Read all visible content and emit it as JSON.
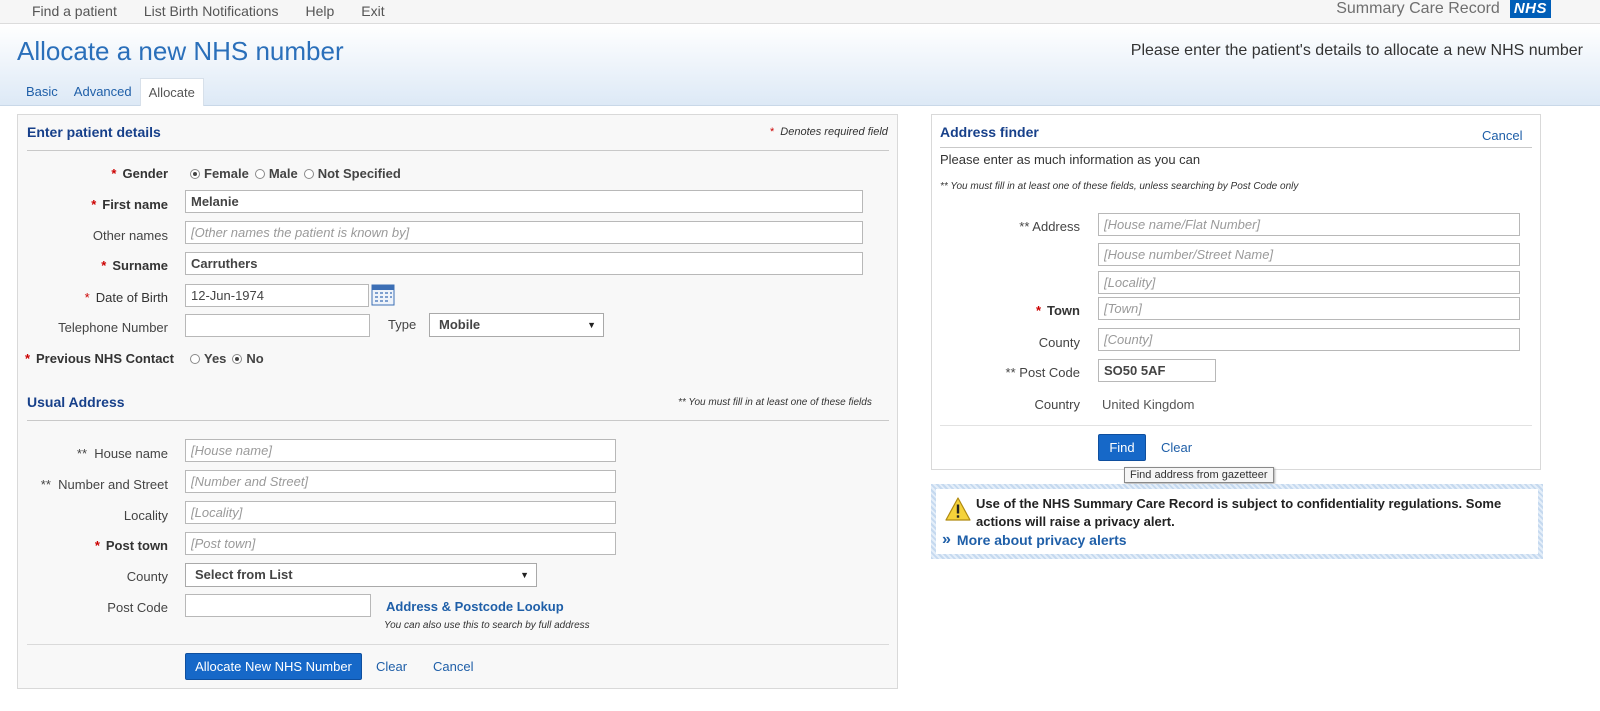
{
  "topnav": {
    "items": [
      "Find a patient",
      "List Birth Notifications",
      "Help",
      "Exit"
    ],
    "brand_title": "Summary Care Record",
    "brand_logo": "NHS"
  },
  "header": {
    "title": "Allocate a new NHS number",
    "subtitle": "Please enter the patient's details to allocate a new NHS number",
    "tabs": [
      {
        "label": "Basic",
        "active": false
      },
      {
        "label": "Advanced",
        "active": false
      },
      {
        "label": "Allocate",
        "active": true
      }
    ]
  },
  "patient": {
    "title": "Enter patient details",
    "required_star": "*",
    "required_note": "Denotes required field",
    "gender": {
      "label": "Gender",
      "options": [
        "Female",
        "Male",
        "Not Specified"
      ],
      "selected": "Female"
    },
    "first_name": {
      "label": "First name",
      "value": "Melanie"
    },
    "other_names": {
      "label": "Other names",
      "placeholder": "[Other names the patient is known by]"
    },
    "surname": {
      "label": "Surname",
      "value": "Carruthers"
    },
    "dob": {
      "label": "Date of Birth",
      "value": "12-Jun-1974"
    },
    "telephone": {
      "label": "Telephone Number",
      "value": ""
    },
    "type": {
      "label": "Type",
      "value": "Mobile"
    },
    "previous_contact": {
      "label": "Previous NHS Contact",
      "options": [
        "Yes",
        "No"
      ],
      "selected": "No"
    }
  },
  "usual_address": {
    "title": "Usual Address",
    "note": "** You must fill in at least one of these fields",
    "house_name": {
      "marker": "**",
      "label": "House name",
      "placeholder": "[House name]"
    },
    "number_street": {
      "marker": "**",
      "label": "Number and Street",
      "placeholder": "[Number and Street]"
    },
    "locality": {
      "label": "Locality",
      "placeholder": "[Locality]"
    },
    "post_town": {
      "label": "Post town",
      "placeholder": "[Post town]"
    },
    "county": {
      "label": "County",
      "value": "Select from List"
    },
    "post_code": {
      "label": "Post Code",
      "value": ""
    },
    "lookup_link": "Address & Postcode Lookup",
    "lookup_note": "You can also use this to search by full address"
  },
  "actions": {
    "allocate": "Allocate New NHS Number",
    "clear": "Clear",
    "cancel": "Cancel"
  },
  "finder": {
    "title": "Address finder",
    "cancel": "Cancel",
    "intro": "Please enter as much information as you can",
    "note": "** You must fill in at least one of these fields, unless searching by Post Code only",
    "address": {
      "marker": "**",
      "label": "Address",
      "placeholders": [
        "[House name/Flat Number]",
        "[House number/Street Name]",
        "[Locality]"
      ]
    },
    "town": {
      "label": "Town",
      "placeholder": "[Town]"
    },
    "county": {
      "label": "County",
      "placeholder": "[County]"
    },
    "post_code": {
      "marker": "**",
      "label": "Post Code",
      "value": "SO50 5AF"
    },
    "country": {
      "label": "Country",
      "value": "United Kingdom"
    },
    "find": "Find",
    "clear": "Clear",
    "tooltip": "Find address from gazetteer"
  },
  "privacy": {
    "message": "Use of the NHS Summary Care Record is subject to confidentiality regulations. Some actions will raise a privacy alert.",
    "link": "More about privacy alerts"
  },
  "colors": {
    "accent": "#1f5fa8",
    "section_title": "#17408a",
    "required": "#cc0000",
    "primary_button": "#1668c8",
    "nhs_blue": "#005eb8"
  }
}
